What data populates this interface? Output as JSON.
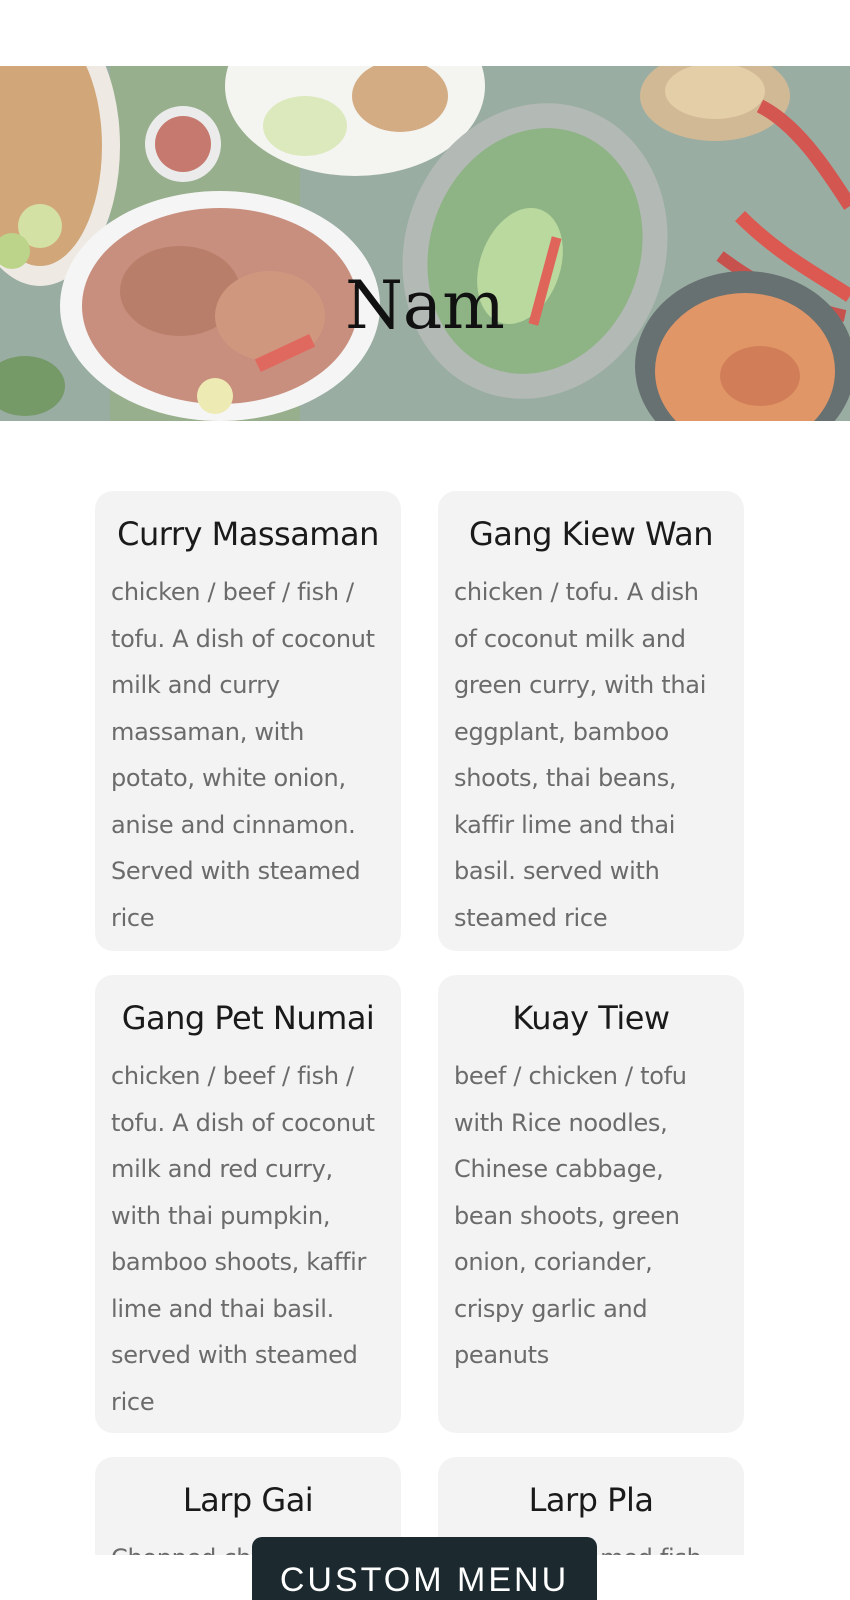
{
  "hero": {
    "title": "Nam",
    "image_icon": "food-photo-image"
  },
  "menu": {
    "items": [
      {
        "name": "Curry Massaman",
        "description": "chicken / beef / fish / tofu. A dish of coconut milk and curry massaman, with potato, white onion, anise and cinnamon. Served with steamed rice"
      },
      {
        "name": "Gang Kiew Wan",
        "description": "chicken / tofu. A dish of coconut milk and green curry, with thai eggplant, bamboo shoots, thai beans, kaffir lime and thai basil. served with steamed rice"
      },
      {
        "name": "Gang Pet Numai",
        "description": "chicken / beef / fish / tofu. A dish of coconut milk and red curry, with thai pumpkin, bamboo shoots, kaffir lime and thai basil. served with steamed rice"
      },
      {
        "name": "Kuay Tiew",
        "description": "beef / chicken / tofu with Rice noodles, Chinese cabbage, bean shoots, green onion, coriander, crispy garlic and peanuts"
      },
      {
        "name": "Larp Gai",
        "description": "Chopped chicken, mint,"
      },
      {
        "name": "Larp Pla",
        "description": "Crispy / steamed fish,"
      }
    ]
  },
  "cta": {
    "label": "CUSTOM MENU"
  },
  "colors": {
    "card_bg": "#f3f3f3",
    "cta_bg": "#1c2a2f",
    "title_text": "#1a1a1a",
    "body_text": "#6b6b6b"
  }
}
